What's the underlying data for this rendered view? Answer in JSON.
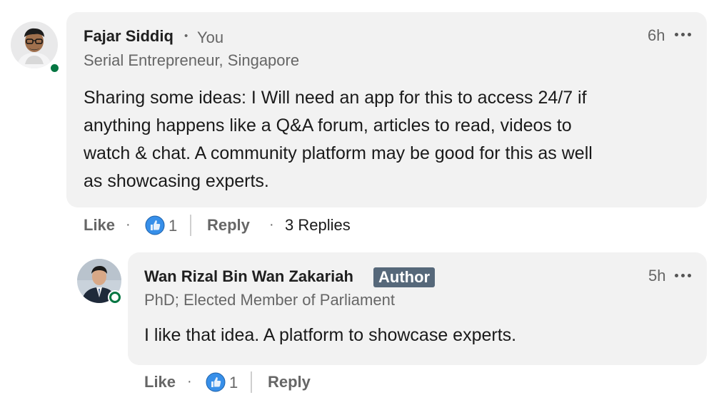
{
  "comment": {
    "author": "Fajar Siddiq",
    "separator": "•",
    "you_label": "You",
    "headline": "Serial Entrepreneur, Singapore",
    "time": "6h",
    "text_lines": [
      "Sharing some ideas: I Will need an app for this to access 24/7 if",
      "anything happens like a Q&A forum, articles to read, videos to",
      "watch & chat. A community platform may be good for this as well",
      "as showcasing experts."
    ],
    "actions": {
      "like": "Like",
      "dot": "·",
      "reaction_count": "1",
      "reply": "Reply",
      "replies": "3 Replies"
    }
  },
  "reply": {
    "author": "Wan Rizal Bin Wan Zakariah",
    "badge": "Author",
    "headline": "PhD; Elected Member of Parliament",
    "time": "5h",
    "text": "I like that idea. A platform to showcase experts.",
    "actions": {
      "like": "Like",
      "dot": "·",
      "reaction_count": "1",
      "reply": "Reply"
    }
  },
  "colors": {
    "bubble": "#f2f2f2",
    "online": "#057642",
    "like_blue": "#378fe9",
    "badge_bg": "#56687a"
  },
  "icons": [
    "more-icon",
    "like-reaction-icon",
    "online-status-icon"
  ]
}
